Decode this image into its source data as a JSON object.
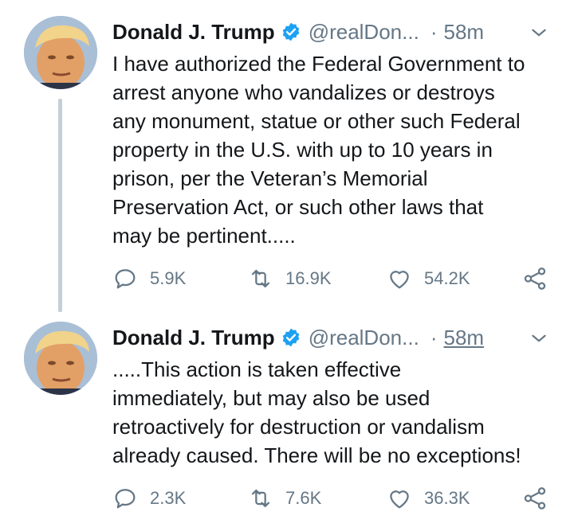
{
  "tweets": [
    {
      "author_name": "Donald J. Trump",
      "handle": "@realDon...",
      "separator": "·",
      "time": "58m",
      "text_lines": [
        "I have authorized the Federal Government to",
        "arrest anyone who vandalizes or destroys",
        "any monument, statue or other such Federal",
        "property in the U.S. with up to 10 years in",
        "prison, per the Veteran’s Memorial",
        "Preservation Act, or such other laws that",
        "may be pertinent....."
      ],
      "replies": "5.9K",
      "retweets": "16.9K",
      "likes": "54.2K"
    },
    {
      "author_name": "Donald J. Trump",
      "handle": "@realDon...",
      "separator": "·",
      "time": "58m",
      "text_lines": [
        ".....This action is taken effective",
        "immediately, but may also be used",
        "retroactively for destruction or vandalism",
        "already caused. There will be no exceptions!"
      ],
      "replies": "2.3K",
      "retweets": "7.6K",
      "likes": "36.3K"
    }
  ],
  "icons": {
    "verified": "verified-badge-icon",
    "menu": "chevron-down-icon",
    "reply": "reply-icon",
    "retweet": "retweet-icon",
    "like": "heart-icon",
    "share": "share-icon"
  },
  "colors": {
    "verified_blue": "#1da1f2",
    "secondary_text": "#657786",
    "thread_line": "#c5cfd8"
  }
}
